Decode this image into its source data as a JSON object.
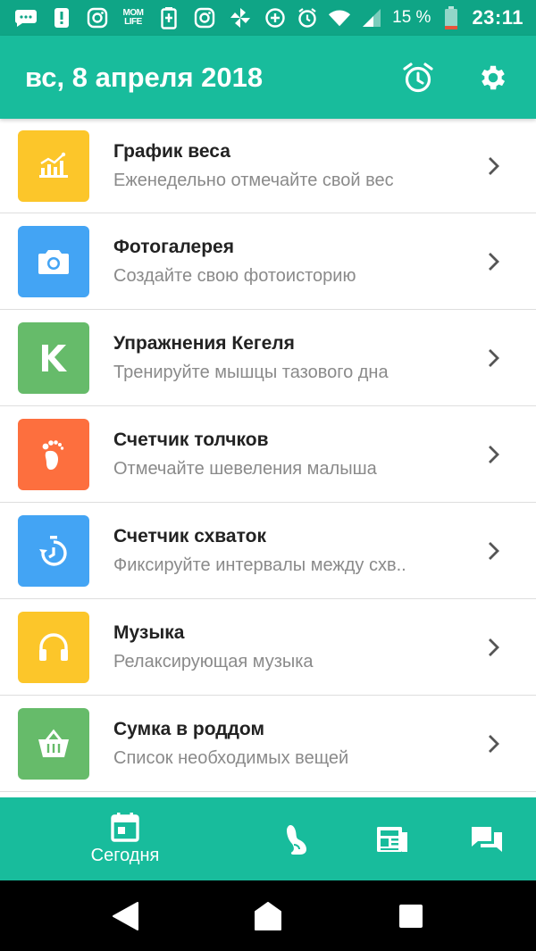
{
  "status_bar": {
    "mom_life_line1": "MOM",
    "mom_life_line2": "LIFE",
    "battery_percent": "15 %",
    "time": "23:11"
  },
  "app_bar": {
    "title": "вс, 8 апреля 2018",
    "alarm_icon": "alarm-clock-icon",
    "settings_icon": "gear-icon"
  },
  "items": [
    {
      "title": "График веса",
      "subtitle": "Еженедельно отмечайте свой вес",
      "color": "#fcc62a",
      "icon": "weight-chart-icon"
    },
    {
      "title": "Фотогалерея",
      "subtitle": "Создайте свою фотоисторию",
      "color": "#43a4f4",
      "icon": "camera-icon"
    },
    {
      "title": "Упражнения Кегеля",
      "subtitle": "Тренируйте мышцы тазового дна",
      "color": "#66bb6a",
      "icon": "kegel-k-icon"
    },
    {
      "title": "Счетчик толчков",
      "subtitle": "Отмечайте шевеления малыша",
      "color": "#fd6f3e",
      "icon": "footprint-icon"
    },
    {
      "title": "Счетчик схваток",
      "subtitle": "Фиксируйте интервалы между схв..",
      "color": "#43a4f4",
      "icon": "stopwatch-icon"
    },
    {
      "title": "Музыка",
      "subtitle": "Релаксирующая музыка",
      "color": "#fcc62a",
      "icon": "headphones-icon"
    },
    {
      "title": "Сумка в роддом",
      "subtitle": "Список необходимых вещей",
      "color": "#66bb6a",
      "icon": "shopping-bag-icon"
    }
  ],
  "bottom_nav": {
    "today_label": "Сегодня"
  },
  "colors": {
    "status_bar": "#0fa586",
    "primary": "#18bc9c"
  }
}
